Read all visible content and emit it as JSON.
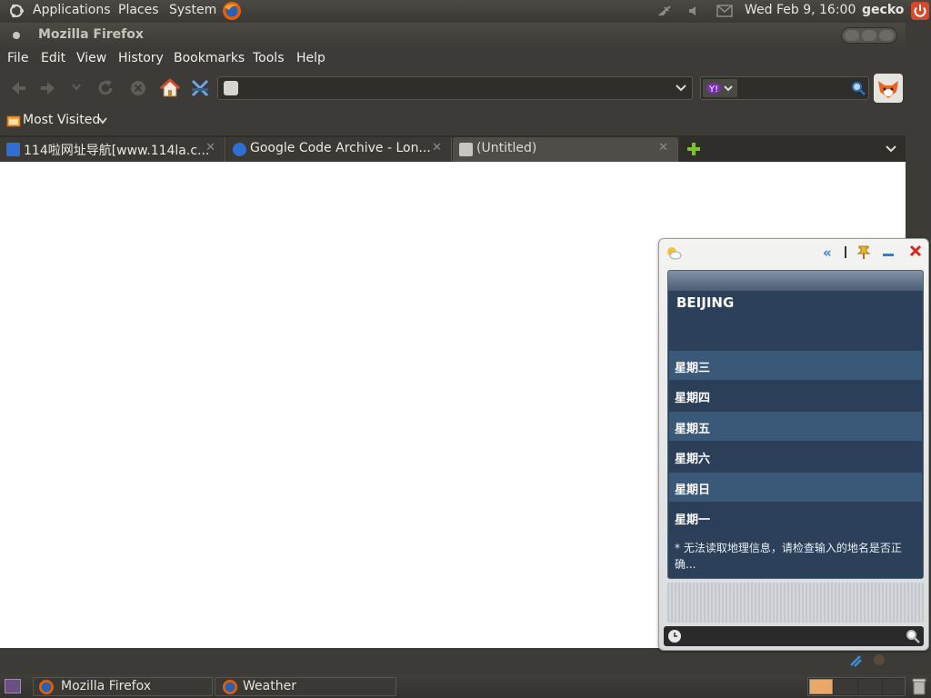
{
  "top_panel": {
    "applications": "Applications",
    "places": "Places",
    "system": "System",
    "clock": "Wed Feb  9, 16:00",
    "user": "gecko"
  },
  "window": {
    "title": "Mozilla Firefox"
  },
  "menu": {
    "file": "File",
    "edit": "Edit",
    "view": "View",
    "history": "History",
    "bookmarks": "Bookmarks",
    "tools": "Tools",
    "help": "Help"
  },
  "bookmarks_bar": {
    "most_visited": "Most Visited"
  },
  "tabs": [
    {
      "label": "114啦网址导航[www.114la.c..."
    },
    {
      "label": "Google Code Archive - Lon..."
    },
    {
      "label": "(Untitled)"
    }
  ],
  "weather": {
    "city": "BEIJING",
    "days": [
      "星期三",
      "星期四",
      "星期五",
      "星期六",
      "星期日",
      "星期一"
    ],
    "error": "* 无法读取地理信息，请检查输入的地名是否正确..."
  },
  "taskbar": {
    "items": [
      {
        "label": "Mozilla Firefox"
      },
      {
        "label": "Weather"
      }
    ]
  },
  "colors": {
    "panel_bg": "#3c3b37",
    "weather_panel": "#2c405a",
    "weather_row_light": "#3a5878",
    "weather_row_dark": "#2b3f59"
  }
}
